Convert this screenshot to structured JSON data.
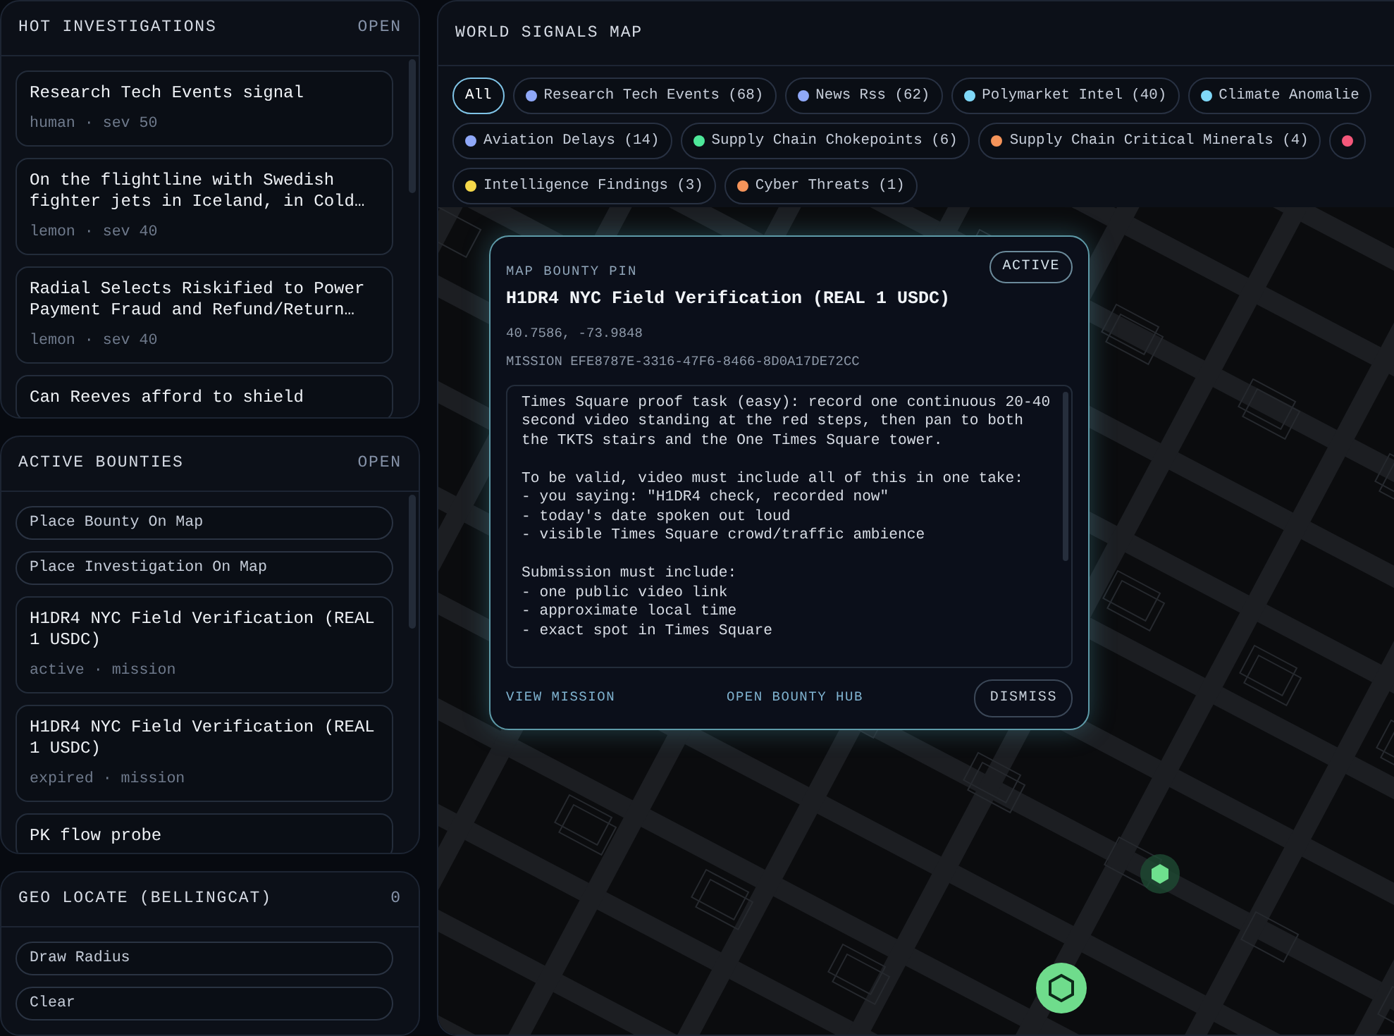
{
  "panels": [
    {
      "title": "HOT INVESTIGATIONS",
      "action": "OPEN",
      "items": [
        {
          "kind": "card",
          "title": "Research Tech Events signal",
          "meta": "human · sev 50"
        },
        {
          "kind": "card",
          "title": "On the flightline with Swedish fighter jets in Iceland, in Cold…",
          "meta": "lemon · sev 40"
        },
        {
          "kind": "card",
          "title": "Radial Selects Riskified to Power Payment Fraud and Refund/Return…",
          "meta": "lemon · sev 40"
        },
        {
          "kind": "card",
          "title": "Can Reeves afford to shield"
        }
      ]
    },
    {
      "title": "ACTIVE BOUNTIES",
      "action": "OPEN",
      "items": [
        {
          "kind": "pill",
          "title": "Place Bounty On Map"
        },
        {
          "kind": "pill",
          "title": "Place Investigation On Map"
        },
        {
          "kind": "card",
          "title": "H1DR4 NYC Field Verification (REAL 1 USDC)",
          "meta": "active · mission"
        },
        {
          "kind": "card",
          "title": "H1DR4 NYC Field Verification (REAL 1 USDC)",
          "meta": "expired · mission"
        },
        {
          "kind": "card",
          "title": "PK flow probe"
        }
      ]
    },
    {
      "title": "GEO LOCATE (BELLINGCAT)",
      "count": "0",
      "items": [
        {
          "kind": "pill",
          "title": "Draw Radius"
        },
        {
          "kind": "pill",
          "title": "Clear"
        }
      ]
    }
  ],
  "map": {
    "title": "WORLD SIGNALS MAP",
    "filter_rows": [
      [
        {
          "label": "All",
          "selected": true
        },
        {
          "label": "Research Tech Events (68)",
          "color": "#8fa8f8",
          "selected": false
        },
        {
          "label": "News Rss (62)",
          "color": "#8fa8f8",
          "selected": false
        },
        {
          "label": "Polymarket Intel (40)",
          "color": "#7fd8f8",
          "selected": false
        },
        {
          "label": "Climate Anomalie",
          "color": "#7fd8f8",
          "selected": false
        }
      ],
      [
        {
          "label": "Aviation Delays (14)",
          "color": "#8fa8f8",
          "selected": false
        },
        {
          "label": "Supply Chain Chokepoints (6)",
          "color": "#4ee89a",
          "selected": false
        },
        {
          "label": "Supply Chain Critical Minerals (4)",
          "color": "#f5945a",
          "selected": false
        },
        {
          "color": "#f4577a",
          "selected": false
        }
      ],
      [
        {
          "label": "Intelligence Findings (3)",
          "color": "#f5d84a",
          "selected": false
        },
        {
          "label": "Cyber Threats (1)",
          "color": "#f5945a",
          "selected": false
        }
      ]
    ],
    "popup": {
      "eyebrow": "MAP BOUNTY PIN",
      "status": "ACTIVE",
      "title": "H1DR4 NYC Field Verification (REAL 1 USDC)",
      "coords": "40.7586, -73.9848",
      "mission": "MISSION EFE8787E-3316-47F6-8466-8D0A17DE72CC",
      "body": [
        "Times Square proof task (easy): record one continuous 20-40 second video standing at the red steps, then pan to both the TKTS stairs and the One Times Square tower.",
        "To be valid, video must include all of this in one take:\n- you saying: \"H1DR4 check, recorded now\"\n- today's date spoken out loud\n- visible Times Square crowd/traffic ambience",
        "Submission must include:\n- one public video link\n- approximate local time\n- exact spot in Times Square"
      ],
      "links": [
        "VIEW MISSION",
        "OPEN BOUNTY HUB"
      ],
      "dismiss": "DISMISS"
    },
    "markers": [
      {
        "kind": "small"
      },
      {
        "kind": "large"
      }
    ]
  }
}
